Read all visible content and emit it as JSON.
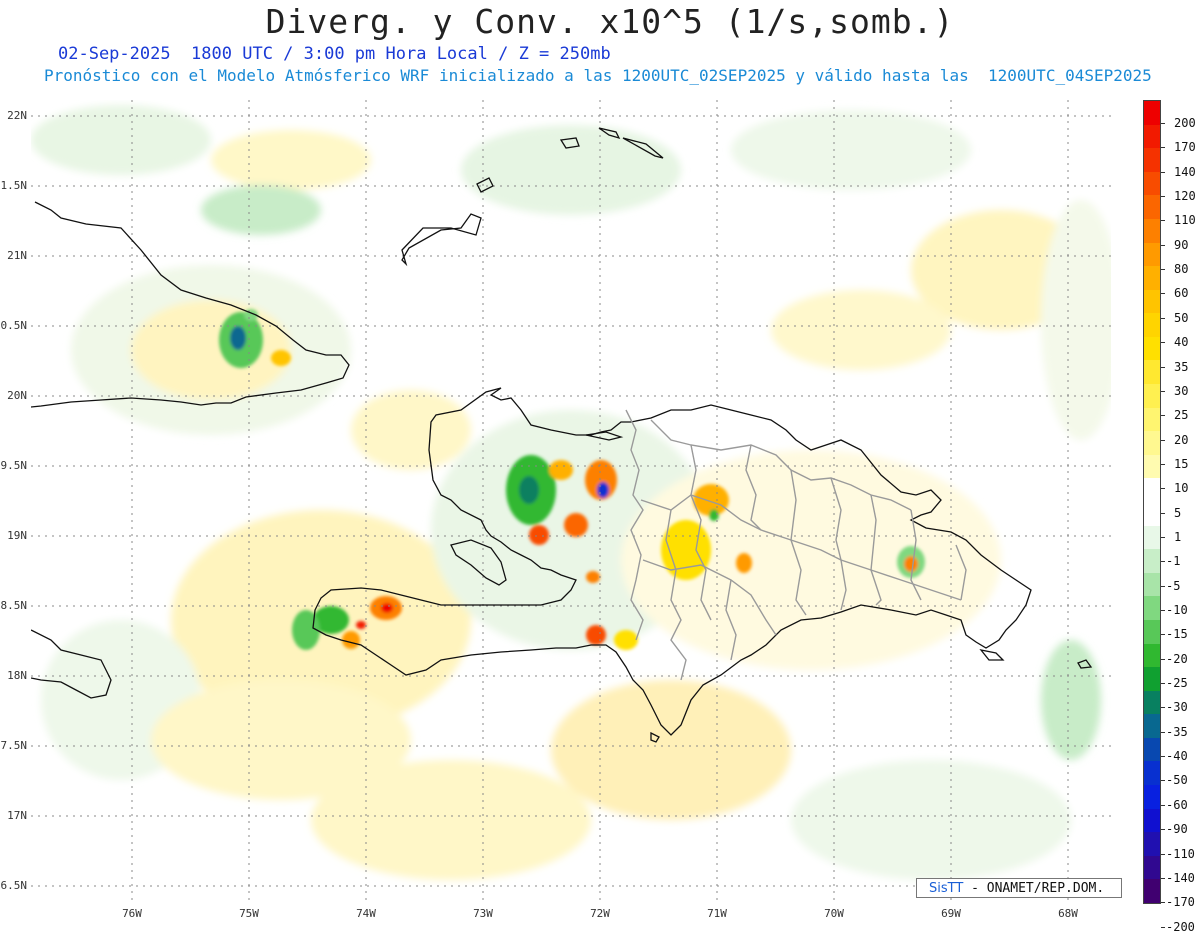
{
  "header": {
    "title": "Diverg. y Conv. x10^5 (1/s,somb.)",
    "subtitle_1": "02-Sep-2025  1800 UTC / 3:00 pm Hora Local / Z = 250mb",
    "subtitle_2": "Pronóstico con el Modelo Atmósferico WRF inicializado a las 1200UTC_02SEP2025 y válido hasta las  1200UTC_04SEP2025"
  },
  "axes": {
    "lat_labels": [
      "22N",
      "1.5N",
      "21N",
      "0.5N",
      "20N",
      "9.5N",
      "19N",
      "8.5N",
      "18N",
      "7.5N",
      "17N",
      "6.5N"
    ],
    "lon_labels": [
      "76W",
      "75W",
      "74W",
      "73W",
      "72W",
      "71W",
      "70W",
      "69W",
      "68W"
    ]
  },
  "colorbar": {
    "labels": [
      "200",
      "170",
      "140",
      "120",
      "110",
      "90",
      "80",
      "60",
      "50",
      "40",
      "35",
      "30",
      "25",
      "20",
      "15",
      "10",
      "5",
      "1",
      "-1",
      "-5",
      "-10",
      "-15",
      "-20",
      "-25",
      "-30",
      "-35",
      "-40",
      "-50",
      "-60",
      "-90",
      "-110",
      "-140",
      "-170",
      "-200"
    ],
    "colors": [
      "#ee0000",
      "#f21a00",
      "#f53200",
      "#f84c00",
      "#fb6600",
      "#fd8000",
      "#ff9a00",
      "#ffb000",
      "#ffc400",
      "#ffd400",
      "#ffe000",
      "#ffe830",
      "#fff050",
      "#fff570",
      "#fff890",
      "#fffbb0",
      "#ffffff",
      "#ffffff",
      "#e8f8e8",
      "#c8eec8",
      "#a8e4a8",
      "#80d880",
      "#58c858",
      "#30b830",
      "#10a030",
      "#088060",
      "#086890",
      "#0848b0",
      "#0830d0",
      "#0820e0",
      "#1010d0",
      "#2010b0",
      "#300890",
      "#400070"
    ]
  },
  "credit": {
    "logo": "SisTT",
    "text": "- ONAMET/REP.DOM."
  },
  "colors": {
    "land_outline": "#111111",
    "province_outline": "#9a9a9a",
    "grid": "#888888"
  }
}
